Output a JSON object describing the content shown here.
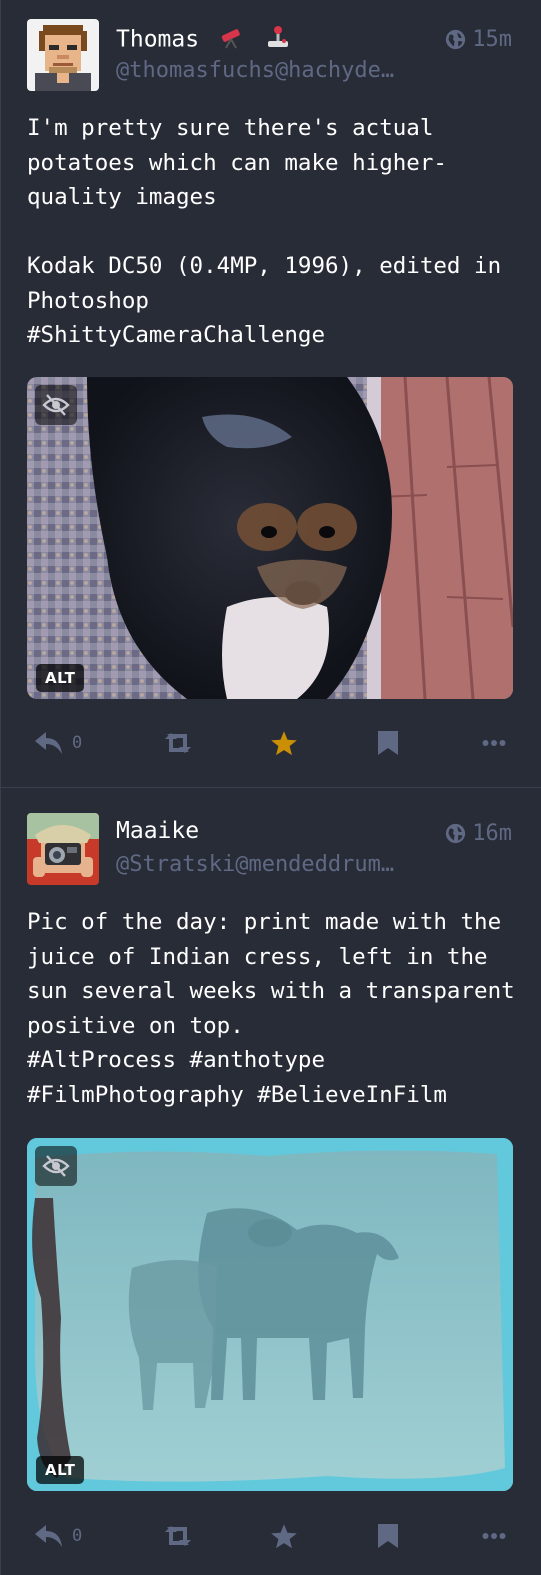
{
  "posts": [
    {
      "display_name": "Thomas",
      "handle": "@thomasfuchs@hachyde…",
      "time": "15m",
      "content": "I'm pretty sure there's actual potatoes which can make higher-quality images\n\nKodak DC50 (0.4MP, 1996), edited in Photoshop\n#ShittyCameraChallenge",
      "media_alt_badge": "ALT",
      "reply_count": "0",
      "favourited": true
    },
    {
      "display_name": "Maaike",
      "handle": "@Stratski@mendeddrum…",
      "time": "16m",
      "content": "Pic of the day: print made with the juice of Indian cress, left in the sun several weeks with a transparent positive on top.\n#AltProcess #anthotype\n#FilmPhotography #BelieveInFilm",
      "media_alt_badge": "ALT",
      "reply_count": "0",
      "favourited": false
    }
  ],
  "colors": {
    "background": "#282c37",
    "muted": "#606984",
    "favourite_active": "#ca8f04",
    "divider": "#393f4f"
  },
  "icons": [
    "globe-icon",
    "reply-icon",
    "boost-icon",
    "star-icon",
    "bookmark-icon",
    "more-icon",
    "eye-off-icon",
    "telescope-emoji",
    "joystick-emoji"
  ]
}
